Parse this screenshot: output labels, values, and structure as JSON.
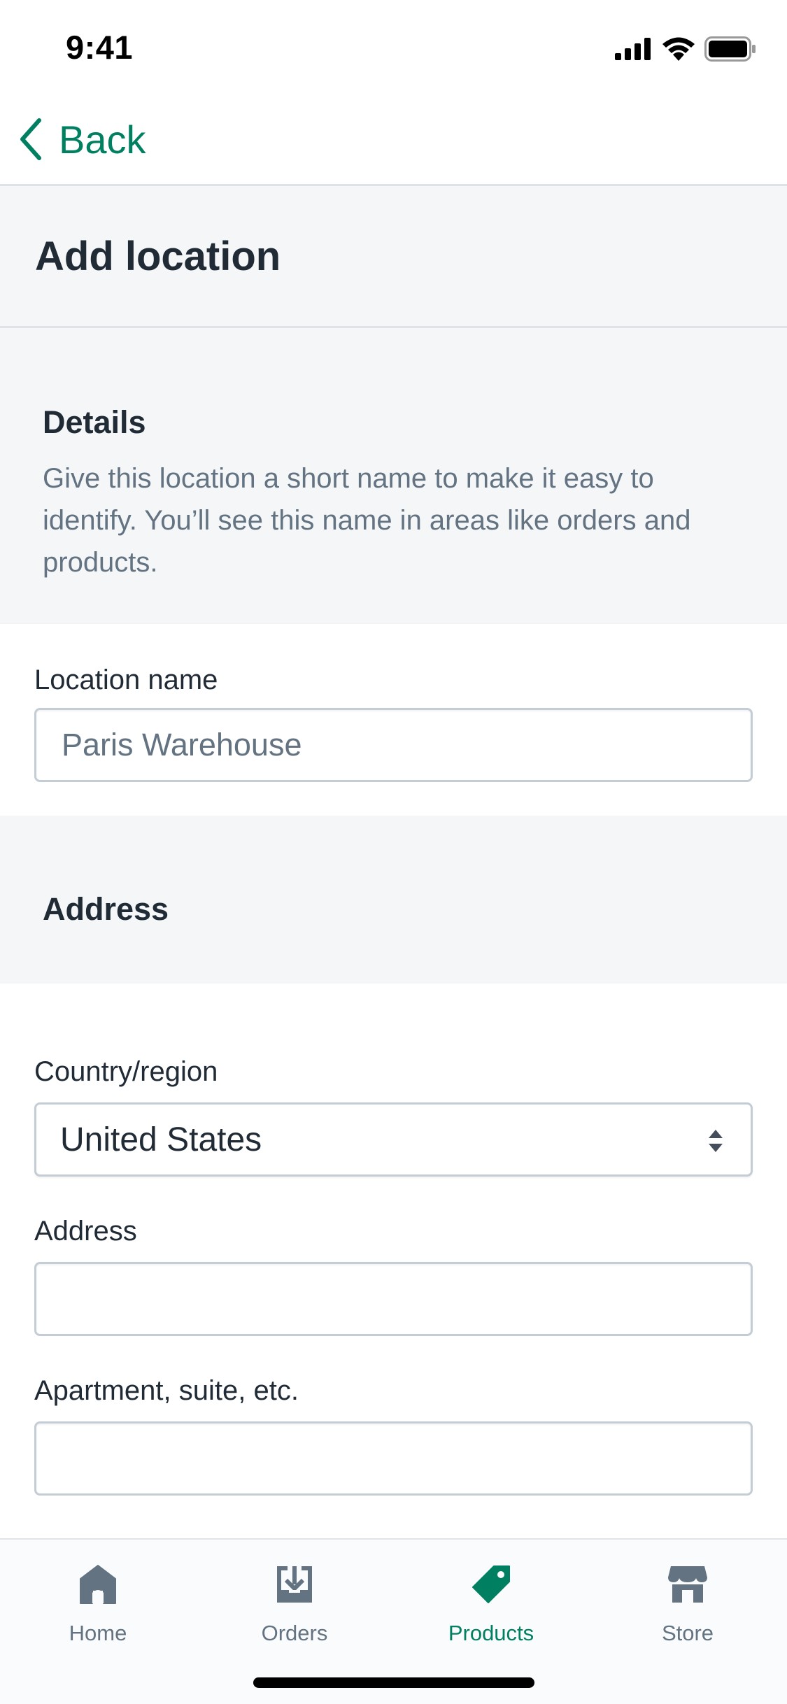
{
  "status_bar": {
    "time": "9:41",
    "icons": [
      "signal-icon",
      "wifi-icon",
      "battery-icon"
    ]
  },
  "nav": {
    "back_label": "Back",
    "back_icon": "chevron-left-icon"
  },
  "page": {
    "title": "Add location"
  },
  "details": {
    "heading": "Details",
    "description": "Give this location a short name to make it easy to identify. You’ll see this name in areas like orders and products."
  },
  "location_name": {
    "label": "Location name",
    "value": "",
    "placeholder": "Paris Warehouse"
  },
  "address_section": {
    "heading": "Address"
  },
  "country": {
    "label": "Country/region",
    "selected": "United States",
    "icon": "select-arrows-icon"
  },
  "address": {
    "label": "Address",
    "value": "",
    "placeholder": ""
  },
  "apartment": {
    "label": "Apartment, suite, etc.",
    "value": "",
    "placeholder": ""
  },
  "tabs": [
    {
      "label": "Home",
      "icon": "home-icon",
      "active": false
    },
    {
      "label": "Orders",
      "icon": "orders-icon",
      "active": false
    },
    {
      "label": "Products",
      "icon": "tag-icon",
      "active": true
    },
    {
      "label": "Store",
      "icon": "store-icon",
      "active": false
    }
  ],
  "colors": {
    "accent": "#008060",
    "text": "#212b36",
    "subdued": "#637381",
    "background": "#f4f6f8",
    "border": "#c4cdd5"
  }
}
